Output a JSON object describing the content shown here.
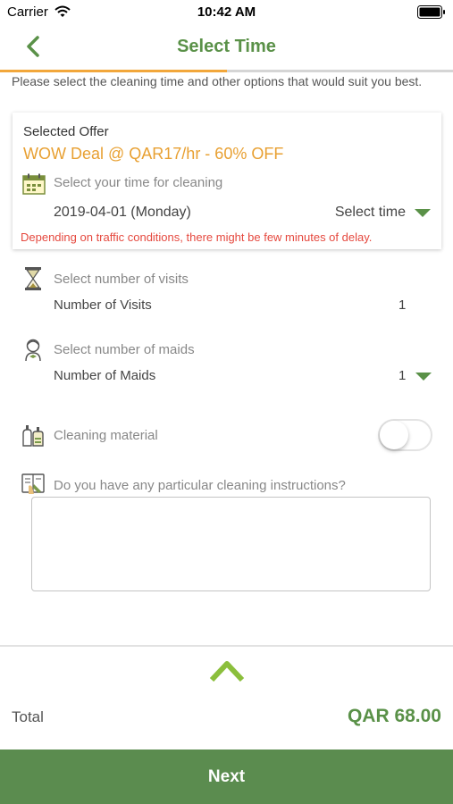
{
  "status_bar": {
    "carrier": "Carrier",
    "time": "10:42 AM"
  },
  "header": {
    "title": "Select Time",
    "back_icon": "chevron-left-icon"
  },
  "progress": {
    "fraction": 0.5,
    "track_color": "#d5d5d5",
    "fill_color": "#f2a73b"
  },
  "intro_text": "Please select the cleaning time  and other options that would suit you best.",
  "offer": {
    "heading": "Selected Offer",
    "name": "WOW Deal @ QAR17/hr - 60% OFF",
    "time_prompt": "Select your time for cleaning",
    "date": "2019-04-01 (Monday)",
    "select_time_label": "Select time",
    "delay_note": "Depending on traffic conditions, there might be few minutes of delay."
  },
  "visits": {
    "prompt": "Select number of visits",
    "label": "Number of Visits",
    "count": "1"
  },
  "maids": {
    "prompt": "Select number of maids",
    "label": "Number of Maids",
    "count": "1"
  },
  "material": {
    "label": "Cleaning material",
    "enabled": false
  },
  "instructions": {
    "prompt": "Do you have any particular cleaning instructions?",
    "value": ""
  },
  "footer": {
    "total_label": "Total",
    "total_value": "QAR 68.00",
    "next_label": "Next"
  },
  "colors": {
    "brand_green": "#5a9148",
    "accent_orange": "#e8a032",
    "warning_red": "#e5483e",
    "next_button": "#5b8c4f"
  },
  "icons": [
    "wifi-icon",
    "battery-icon",
    "chevron-left-icon",
    "calendar-icon",
    "caret-down-icon",
    "hourglass-icon",
    "maid-icon",
    "cleaning-bottles-icon",
    "notes-icon",
    "chevron-up-icon"
  ]
}
